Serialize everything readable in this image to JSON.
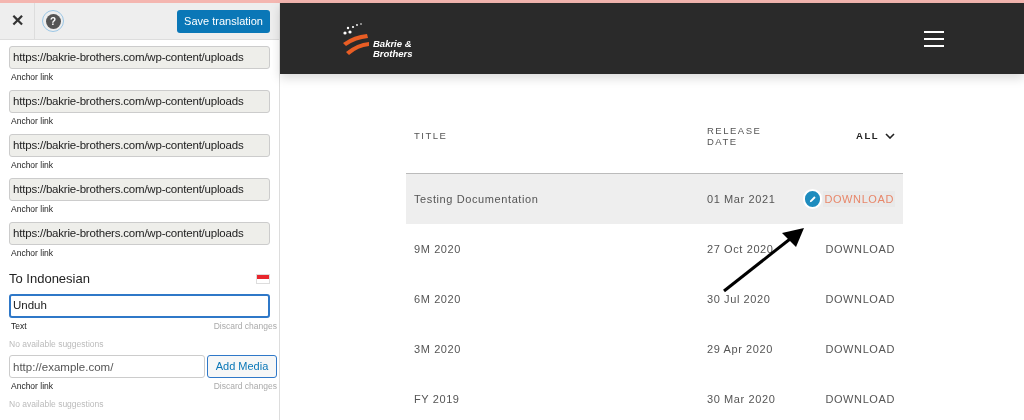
{
  "sidebar": {
    "save_button": "Save translation",
    "close_icon": "✕",
    "help_icon": "?",
    "sources": [
      {
        "value": "https://bakrie-brothers.com/wp-content/uploads",
        "label": "Anchor link"
      },
      {
        "value": "https://bakrie-brothers.com/wp-content/uploads",
        "label": "Anchor link"
      },
      {
        "value": "https://bakrie-brothers.com/wp-content/uploads",
        "label": "Anchor link"
      },
      {
        "value": "https://bakrie-brothers.com/wp-content/uploads",
        "label": "Anchor link"
      },
      {
        "value": "https://bakrie-brothers.com/wp-content/uploads",
        "label": "Anchor link"
      }
    ],
    "target_heading": "To Indonesian",
    "translations": [
      {
        "kind": "text",
        "value": "Unduh",
        "label": "Text",
        "discard": "Discard changes",
        "suggestions": "No available suggestions"
      },
      {
        "kind": "url",
        "placeholder": "http://example.com/",
        "button": "Add Media",
        "label": "Anchor link",
        "discard": "Discard changes",
        "suggestions": "No available suggestions"
      }
    ]
  },
  "site": {
    "logo_text": [
      "Bakrie &",
      "Brothers"
    ],
    "table": {
      "columns": [
        "TITLE",
        "RELEASE DATE"
      ],
      "filter": "ALL",
      "rows": [
        {
          "title": "Testing Documentation",
          "date": "01 Mar 2021",
          "action": "DOWNLOAD",
          "selected": true
        },
        {
          "title": "9M 2020",
          "date": "27 Oct 2020",
          "action": "DOWNLOAD",
          "selected": false
        },
        {
          "title": "6M 2020",
          "date": "30 Jul 2020",
          "action": "DOWNLOAD",
          "selected": false
        },
        {
          "title": "3M 2020",
          "date": "29 Apr 2020",
          "action": "DOWNLOAD",
          "selected": false
        },
        {
          "title": "FY 2019",
          "date": "30 Mar 2020",
          "action": "DOWNLOAD",
          "selected": false
        }
      ]
    }
  }
}
